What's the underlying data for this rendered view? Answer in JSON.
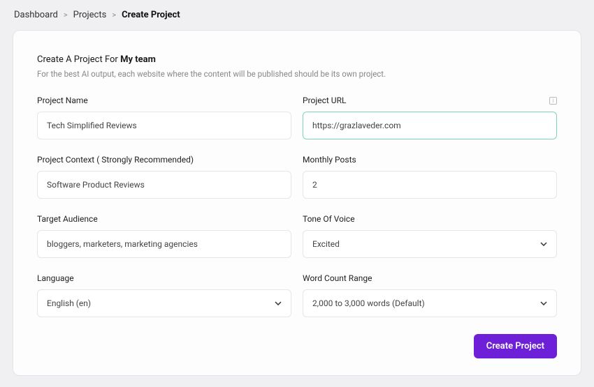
{
  "breadcrumb": {
    "dashboard": "Dashboard",
    "projects": "Projects",
    "current": "Create Project"
  },
  "header": {
    "title_prefix": "Create A Project For ",
    "team_name": "My team",
    "subtitle": "For the best AI output, each website where the content will be published should be its own project."
  },
  "form": {
    "project_name": {
      "label": "Project Name",
      "value": "Tech Simplified Reviews"
    },
    "project_url": {
      "label": "Project URL",
      "value": "https://grazlaveder.com"
    },
    "project_context": {
      "label": "Project Context ( Strongly Recommended)",
      "value": "Software Product Reviews"
    },
    "monthly_posts": {
      "label": "Monthly Posts",
      "value": "2"
    },
    "target_audience": {
      "label": "Target Audience",
      "value": "bloggers, marketers, marketing agencies"
    },
    "tone_of_voice": {
      "label": "Tone Of Voice",
      "selected": "Excited"
    },
    "language": {
      "label": "Language",
      "selected": "English (en)"
    },
    "word_count": {
      "label": "Word Count Range",
      "selected": "2,000 to 3,000 words (Default)"
    }
  },
  "actions": {
    "create": "Create Project"
  }
}
